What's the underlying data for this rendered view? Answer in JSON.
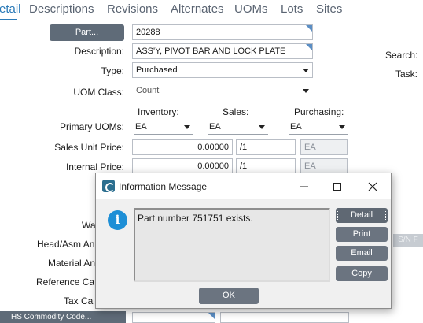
{
  "tabs": [
    "etail",
    "Descriptions",
    "Revisions",
    "Alternates",
    "UOMs",
    "Lots",
    "Sites"
  ],
  "part_button": "Part...",
  "part_number": "20288",
  "labels": {
    "description": "Description:",
    "type": "Type:",
    "uom_class": "UOM Class:",
    "primary_uoms": "Primary UOMs:",
    "sales_unit_price": "Sales Unit Price:",
    "internal_price": "Internal Price:",
    "wa": "Wa",
    "head_asm": "Head/Asm An",
    "material_an": "Material An",
    "reference_ca": "Reference Ca",
    "tax_ca": "Tax Ca",
    "search": "Search:",
    "task": "Task:"
  },
  "values": {
    "description": "ASS'Y, PIVOT BAR AND LOCK PLATE",
    "type": "Purchased",
    "uom_class": "Count"
  },
  "uom_columns": {
    "inventory": "Inventory:",
    "sales": "Sales:",
    "purchasing": "Purchasing:"
  },
  "primary_uoms": {
    "inventory": "EA",
    "sales": "EA",
    "purchasing": "EA"
  },
  "sales_price": {
    "amount": "0.00000",
    "per": "/1",
    "uom": "EA"
  },
  "internal_price": {
    "amount": "0.00000",
    "per": "/1",
    "uom": "EA"
  },
  "sn_button": "S/N F",
  "hs_button": "HS Commodity Code...",
  "dialog": {
    "title": "Information Message",
    "message": "Part number 751751 exists.",
    "buttons": {
      "detail": "Detail",
      "print": "Print",
      "email": "Email",
      "copy": "Copy",
      "ok": "OK"
    },
    "info_symbol": "i"
  },
  "colors": {
    "accent": "#2a7ab8",
    "button": "#5f6b78",
    "dialog_button": "#6b7480",
    "info": "#1e8fd6"
  }
}
